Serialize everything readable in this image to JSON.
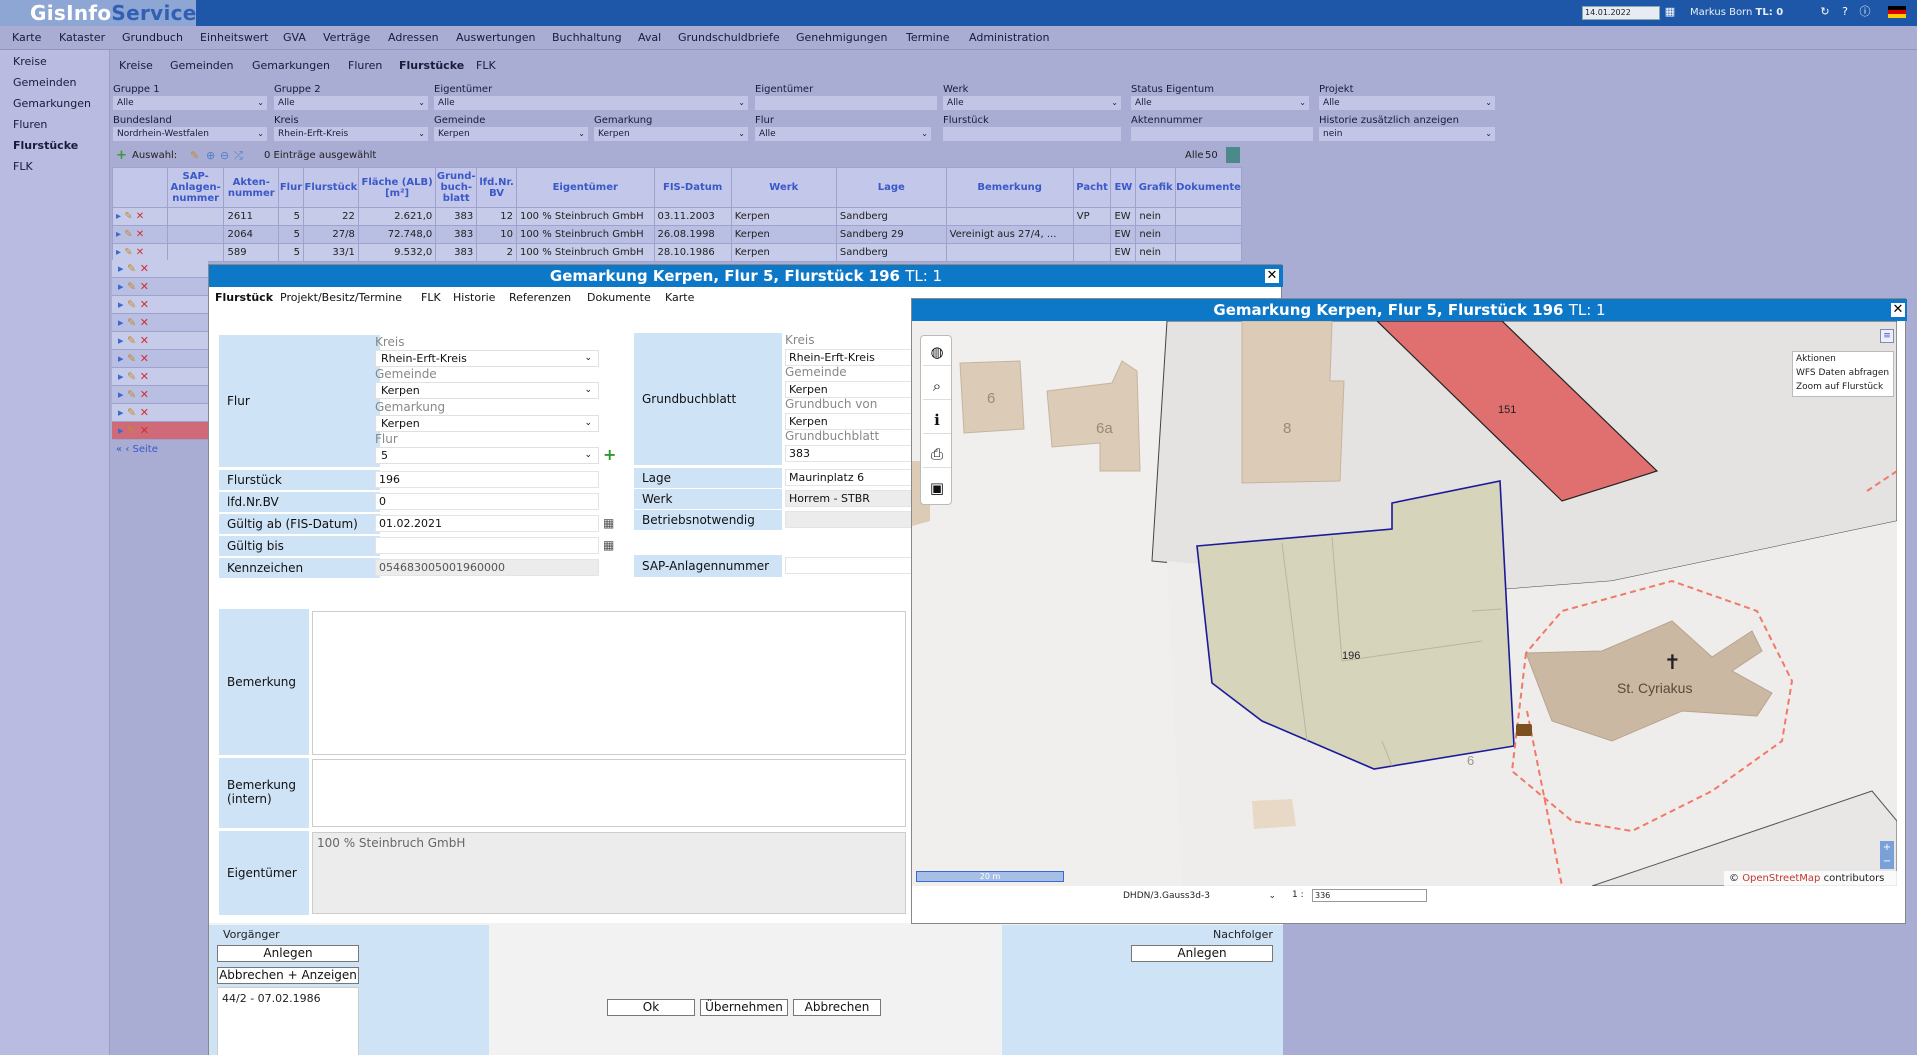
{
  "app": {
    "title_part1": "GisInfo",
    "title_part2": "Service",
    "date": "14.01.2022",
    "user": "Markus Born",
    "tl_label": "TL: 0"
  },
  "menu": [
    "Karte",
    "Kataster",
    "Grundbuch",
    "Einheitswert",
    "GVA",
    "Verträge",
    "Adressen",
    "Auswertungen",
    "Buchhaltung",
    "Aval",
    "Grundschuldbriefe",
    "Genehmigungen",
    "Termine",
    "Administration"
  ],
  "leftnav": [
    "Kreise",
    "Gemeinden",
    "Gemarkungen",
    "Fluren",
    "Flurstücke",
    "FLK"
  ],
  "subtabs": [
    "Kreise",
    "Gemeinden",
    "Gemarkungen",
    "Fluren",
    "Flurstücke",
    "FLK"
  ],
  "filters": {
    "row1": [
      {
        "label": "Gruppe 1",
        "value": "Alle"
      },
      {
        "label": "Gruppe 2",
        "value": "Alle"
      },
      {
        "label": "Eigentümer",
        "value": "Alle"
      },
      {
        "label": "Eigentümer",
        "value": ""
      },
      {
        "label": "Werk",
        "value": "Alle"
      },
      {
        "label": "Status Eigentum",
        "value": "Alle"
      },
      {
        "label": "Projekt",
        "value": "Alle"
      }
    ],
    "row2": [
      {
        "label": "Bundesland",
        "value": "Nordrhein-Westfalen"
      },
      {
        "label": "Kreis",
        "value": "Rhein-Erft-Kreis"
      },
      {
        "label": "Gemeinde",
        "value": "Kerpen"
      },
      {
        "label": "Gemarkung",
        "value": "Kerpen"
      },
      {
        "label": "Flur",
        "value": "Alle"
      },
      {
        "label": "Flurstück",
        "value": ""
      },
      {
        "label": "Aktennummer",
        "value": ""
      },
      {
        "label": "Historie zusätzlich anzeigen",
        "value": "nein"
      }
    ]
  },
  "gridtool": {
    "auswahl": "Auswahl:",
    "selected": "0 Einträge ausgewählt",
    "all": "Alle",
    "count": "50"
  },
  "grid": {
    "headers": [
      "SAP-Anlagen-nummer",
      "Akten-nummer",
      "Flur",
      "Flurstück",
      "Fläche (ALB) [m²]",
      "Grund-buch-blatt",
      "lfd.Nr. BV",
      "Eigentümer",
      "FIS-Datum",
      "Werk",
      "Lage",
      "Bemerkung",
      "Pacht",
      "EW",
      "Grafik",
      "Dokumente"
    ],
    "rows": [
      [
        "",
        "2611",
        "5",
        "22",
        "2.621,0",
        "383",
        "12",
        "100 % Steinbruch GmbH",
        "03.11.2003",
        "Kerpen",
        "Sandberg",
        "",
        "VP",
        "EW",
        "nein",
        ""
      ],
      [
        "",
        "2064",
        "5",
        "27/8",
        "72.748,0",
        "383",
        "10",
        "100 % Steinbruch GmbH",
        "26.08.1998",
        "Kerpen",
        "Sandberg 29",
        "Vereinigt aus 27/4, ...",
        "",
        "EW",
        "nein",
        ""
      ],
      [
        "",
        "589",
        "5",
        "33/1",
        "9.532,0",
        "383",
        "2",
        "100 % Steinbruch GmbH",
        "28.10.1986",
        "Kerpen",
        "Sandberg",
        "",
        "",
        "EW",
        "nein",
        ""
      ]
    ],
    "pager": "Seite"
  },
  "dialog": {
    "title": "Gemarkung Kerpen, Flur 5, Flurstück 196",
    "tl": "TL: 1",
    "tabs": [
      "Flurstück",
      "Projekt/Besitz/Termine",
      "FLK",
      "Historie",
      "Referenzen",
      "Dokumente",
      "Karte"
    ],
    "left": {
      "flur_label": "Flur",
      "kreis_label": "Kreis",
      "kreis": "Rhein-Erft-Kreis",
      "gemeinde_label": "Gemeinde",
      "gemeinde": "Kerpen",
      "gemarkung_label": "Gemarkung",
      "gemarkung": "Kerpen",
      "flur_sub_label": "Flur",
      "flur": "5",
      "flurstueck_label": "Flurstück",
      "flurstueck": "196",
      "lfdnr_label": "lfd.Nr.BV",
      "lfdnr": "0",
      "gueltig_ab_label": "Gültig ab (FIS-Datum)",
      "gueltig_ab": "01.02.2021",
      "gueltig_bis_label": "Gültig bis",
      "gueltig_bis": "",
      "kennzeichen_label": "Kennzeichen",
      "kennzeichen": "054683005001960000"
    },
    "right": {
      "gb_label": "Grundbuchblatt",
      "kreis_label": "Kreis",
      "kreis": "Rhein-Erft-Kreis",
      "gemeinde_label": "Gemeinde",
      "gemeinde": "Kerpen",
      "gbvon_label": "Grundbuch von",
      "gbvon": "Kerpen",
      "gbblatt_label": "Grundbuchblatt",
      "gbblatt": "383",
      "lage_label": "Lage",
      "lage": "Maurinplatz 6",
      "werk_label": "Werk",
      "werk": "Horrem - STBR",
      "betrieb_label": "Betriebsnotwendig",
      "betrieb": "",
      "sap_label": "SAP-Anlagennummer",
      "sap": ""
    },
    "bemerkung_label": "Bemerkung",
    "bemerkung_intern_label": "Bemerkung (intern)",
    "eigentuemer_label": "Eigentümer",
    "eigentuemer": "100 % Steinbruch GmbH",
    "vorgaenger_label": "Vorgänger",
    "nachfolger_label": "Nachfolger",
    "anlegen": "Anlegen",
    "abbrechen_anzeigen": "Abbrechen + Anzeigen",
    "vorgaenger_item": "44/2 - 07.02.1986",
    "ok": "Ok",
    "uebernehmen": "Übernehmen",
    "abbrechen": "Abbrechen"
  },
  "map": {
    "title": "Gemarkung Kerpen, Flur 5, Flurstück 196",
    "tl": "TL: 1",
    "labels": {
      "h6": "6",
      "h6a": "6a",
      "h8": "8",
      "p151": "151",
      "p196": "196",
      "p6": "6",
      "church": "St. Cyriakus"
    },
    "scale_bar": "20 m",
    "crs": "DHDN/3.Gauss3d-3",
    "scale_prefix": "1 :",
    "scale_value": "336",
    "attribution_prefix": "©",
    "attribution_link": "OpenStreetMap",
    "attribution_suffix": "contributors",
    "ctx": [
      "Aktionen",
      "WFS Daten abfragen",
      "Zoom auf Flurstück"
    ]
  }
}
